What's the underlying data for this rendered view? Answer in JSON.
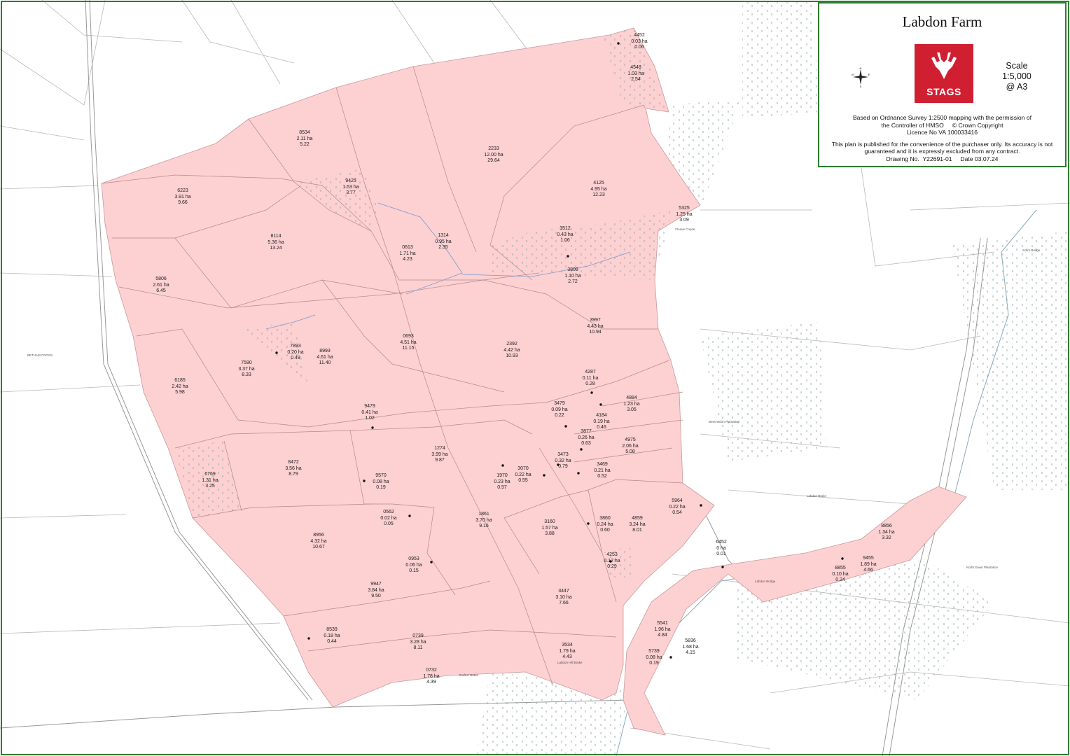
{
  "title": "Labdon Farm",
  "logo": {
    "brand": "STAGS",
    "color": "#d11f32"
  },
  "compass": {
    "icon": "compass-rose-icon",
    "n": "N",
    "s": "S",
    "e": "E",
    "w": "W"
  },
  "scale": {
    "label": "Scale",
    "ratio": "1:5,000",
    "paper": "@ A3"
  },
  "notes": {
    "os_line1": "Based on Ordnance Survey 1:2500 mapping with the permission of",
    "os_line2": "the Controller of HMSO     © Crown Copyright",
    "os_line3": "Licence No VA 100033416",
    "disclaimer1": "This plan is published for the convenience of the purchaser only. Its accuracy is not",
    "disclaimer2": "guaranteed and it is expressly excluded from any contract.",
    "drawing": "Drawing No.  Y22691-01     Date 03.07.24"
  },
  "colors": {
    "holding_fill": "#fdd0d2",
    "frame": "#2e7d32"
  },
  "parcels": [
    {
      "id": "4452",
      "ha": "0.03 ha",
      "ac": "0.06"
    },
    {
      "id": "4548",
      "ha": "1.03 ha",
      "ac": "2.54"
    },
    {
      "id": "8534",
      "ha": "2.11 ha",
      "ac": "5.22"
    },
    {
      "id": "2233",
      "ha": "12.00 ha",
      "ac": "29.64"
    },
    {
      "id": "9425",
      "ha": "1.53 ha",
      "ac": "3.77"
    },
    {
      "id": "6223",
      "ha": "3.91 ha",
      "ac": "9.66"
    },
    {
      "id": "4125",
      "ha": "4.95 ha",
      "ac": "12.23"
    },
    {
      "id": "5325",
      "ha": "1.25 ha",
      "ac": "3.09"
    },
    {
      "id": "8114",
      "ha": "5.36 ha",
      "ac": "13.24"
    },
    {
      "id": "1314",
      "ha": "0.95 ha",
      "ac": "2.35"
    },
    {
      "id": "0613",
      "ha": "1.71 ha",
      "ac": "4.23"
    },
    {
      "id": "3512",
      "ha": "0.43 ha",
      "ac": "1.06"
    },
    {
      "id": "3808",
      "ha": "1.10 ha",
      "ac": "2.72"
    },
    {
      "id": "5806",
      "ha": "2.61 ha",
      "ac": "6.45"
    },
    {
      "id": "3997",
      "ha": "4.43 ha",
      "ac": "10.94"
    },
    {
      "id": "0693",
      "ha": "4.51 ha",
      "ac": "11.15"
    },
    {
      "id": "2392",
      "ha": "4.42 ha",
      "ac": "10.93"
    },
    {
      "id": "7893",
      "ha": "0.20 ha",
      "ac": "0.49"
    },
    {
      "id": "8993",
      "ha": "4.61 ha",
      "ac": "11.40"
    },
    {
      "id": "7590",
      "ha": "3.37 ha",
      "ac": "8.33"
    },
    {
      "id": "4287",
      "ha": "0.11 ha",
      "ac": "0.28"
    },
    {
      "id": "6185",
      "ha": "2.42 ha",
      "ac": "5.98"
    },
    {
      "id": "4884",
      "ha": "1.23 ha",
      "ac": "3.05"
    },
    {
      "id": "3479",
      "ha": "0.09 ha",
      "ac": "0.22"
    },
    {
      "id": "9479",
      "ha": "0.41 ha",
      "ac": "1.02"
    },
    {
      "id": "4184",
      "ha": "0.19 ha",
      "ac": "0.46"
    },
    {
      "id": "3877",
      "ha": "0.26 ha",
      "ac": "0.63"
    },
    {
      "id": "4975",
      "ha": "2.06 ha",
      "ac": "5.08"
    },
    {
      "id": "1274",
      "ha": "3.99 ha",
      "ac": "9.87"
    },
    {
      "id": "3473",
      "ha": "0.32 ha",
      "ac": "0.79"
    },
    {
      "id": "6769",
      "ha": "1.31 ha",
      "ac": "3.25"
    },
    {
      "id": "8472",
      "ha": "3.56 ha",
      "ac": "8.79"
    },
    {
      "id": "3070",
      "ha": "0.22 ha",
      "ac": "0.55"
    },
    {
      "id": "3469",
      "ha": "0.21 ha",
      "ac": "0.52"
    },
    {
      "id": "1970",
      "ha": "0.23 ha",
      "ac": "0.57"
    },
    {
      "id": "9570",
      "ha": "0.08 ha",
      "ac": "0.19"
    },
    {
      "id": "5964",
      "ha": "0.22 ha",
      "ac": "0.54"
    },
    {
      "id": "0562",
      "ha": "0.02 ha",
      "ac": "0.05"
    },
    {
      "id": "1861",
      "ha": "3.70 ha",
      "ac": "9.16"
    },
    {
      "id": "3160",
      "ha": "1.57 ha",
      "ac": "3.88"
    },
    {
      "id": "3860",
      "ha": "0.24 ha",
      "ac": "0.60"
    },
    {
      "id": "4859",
      "ha": "3.24 ha",
      "ac": "8.01"
    },
    {
      "id": "8856",
      "ha": "1.34 ha",
      "ac": "3.32"
    },
    {
      "id": "8956",
      "ha": "4.32 ha",
      "ac": "10.67"
    },
    {
      "id": "6452",
      "ha": "0 ha",
      "ac": "0.01"
    },
    {
      "id": "0953",
      "ha": "0.06 ha",
      "ac": "0.15"
    },
    {
      "id": "4253",
      "ha": "0.12 ha",
      "ac": "0.29"
    },
    {
      "id": "9455",
      "ha": "1.89 ha",
      "ac": "4.66"
    },
    {
      "id": "8855",
      "ha": "0.10 ha",
      "ac": "0.24"
    },
    {
      "id": "9947",
      "ha": "3.84 ha",
      "ac": "9.50"
    },
    {
      "id": "3447",
      "ha": "3.10 ha",
      "ac": "7.66"
    },
    {
      "id": "5541",
      "ha": "1.96 ha",
      "ac": "4.84"
    },
    {
      "id": "8539",
      "ha": "0.18 ha",
      "ac": "0.44"
    },
    {
      "id": "0739",
      "ha": "3.28 ha",
      "ac": "8.11"
    },
    {
      "id": "5836",
      "ha": "1.68 ha",
      "ac": "4.15"
    },
    {
      "id": "5739",
      "ha": "0.08 ha",
      "ac": "0.19"
    },
    {
      "id": "3534",
      "ha": "1.79 ha",
      "ac": "4.43"
    },
    {
      "id": "0732",
      "ha": "1.78 ha",
      "ac": "4.39"
    }
  ],
  "places": [
    {
      "name": "Beechedon Plantation"
    },
    {
      "name": "Labdon Brake"
    },
    {
      "name": "North Down Plantation"
    },
    {
      "name": "Labdon Hill Brake"
    },
    {
      "name": "Grafton Brake"
    },
    {
      "name": "Cleave Copse"
    },
    {
      "name": "Labdon Bridge"
    },
    {
      "name": "BETHAM CROSS"
    },
    {
      "name": "Sou's Bridge"
    }
  ]
}
